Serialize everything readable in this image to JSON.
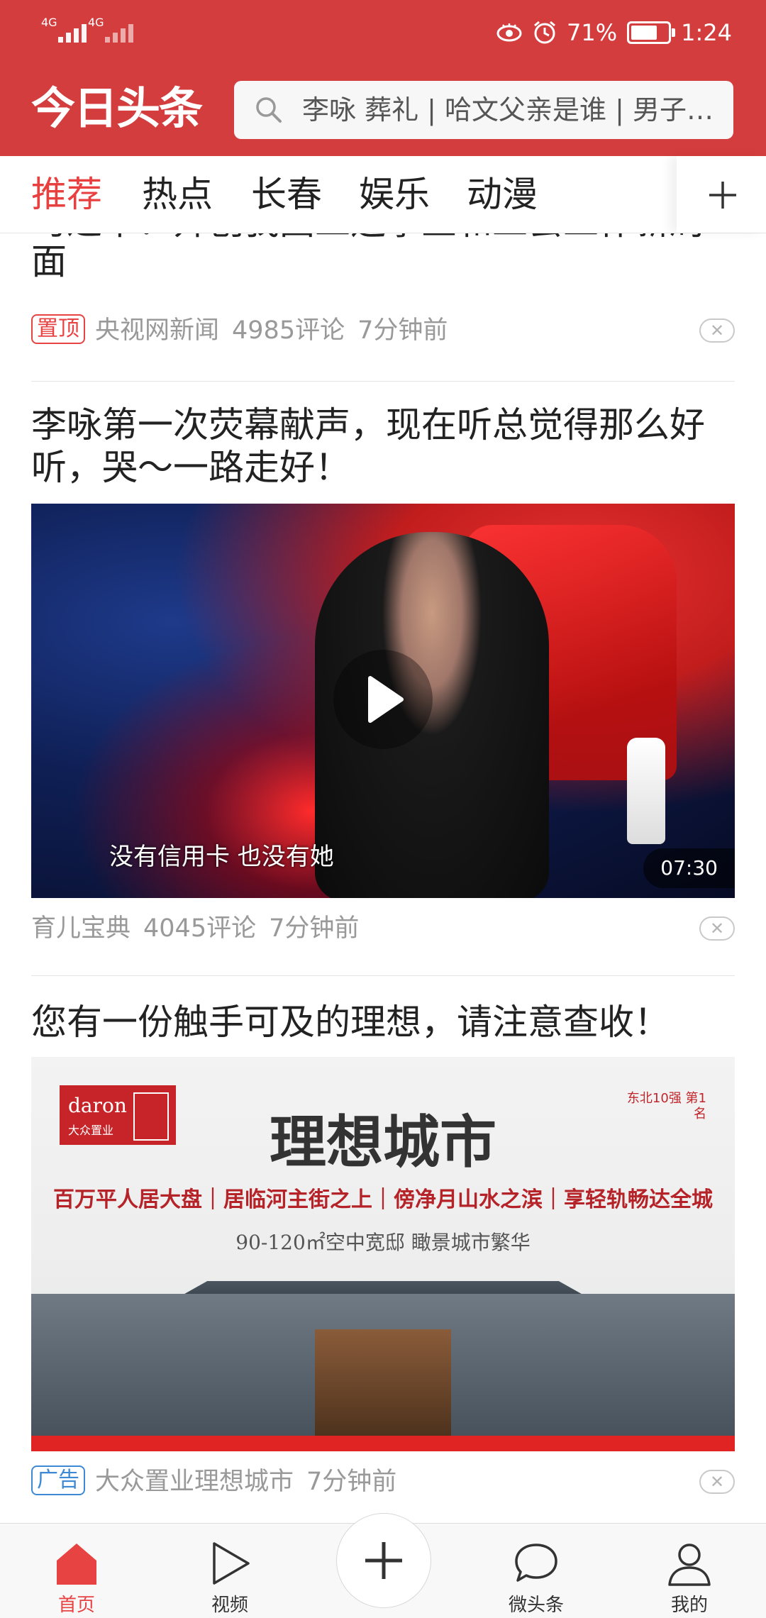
{
  "status_bar": {
    "sim1_label": "4G",
    "sim2_label": "4G",
    "battery_percent": "71%",
    "battery_level": 0.71,
    "time": "1:24",
    "icons": [
      "eye-comfort-icon",
      "alarm-icon",
      "battery-icon"
    ]
  },
  "header": {
    "logo": "今日头条",
    "search_placeholder": "李咏 葬礼 | 哈文父亲是谁 | 男子…",
    "background_color": "#d43d3d"
  },
  "tabs": {
    "items": [
      "推荐",
      "热点",
      "长春",
      "娱乐",
      "动漫"
    ],
    "active_index": 0,
    "active_color": "#e83f3f"
  },
  "feed": {
    "article1": {
      "title_partial_top": "习近平：开创我国工运事业和工会工作新局",
      "title_last_line": "面",
      "badge": "置顶",
      "source": "央视网新闻",
      "comments": "4985评论",
      "time": "7分钟前"
    },
    "article2": {
      "title": "李咏第一次荧幕献声，现在听总觉得那么好听，哭～一路走好！",
      "video_subtitle": "没有信用卡 也没有她",
      "duration": "07:30",
      "source": "育儿宝典",
      "comments": "4045评论",
      "time": "7分钟前"
    },
    "article3": {
      "title": "您有一份触手可及的理想，请注意查收！",
      "ad_brand": "daron",
      "ad_brand_cn": "大众置业",
      "ad_ranking": "东北10强 第1名",
      "ad_headline": "理想城市",
      "ad_slogan": "百万平人居大盘｜居临河主街之上｜傍净月山水之滨｜享轻轨畅达全城",
      "ad_sub": "90-120㎡空中宽邸  瞰景城市繁华",
      "badge": "广告",
      "source": "大众置业理想城市",
      "time": "7分钟前"
    }
  },
  "bottom_nav": {
    "items": [
      {
        "label": "首页",
        "icon": "home-icon"
      },
      {
        "label": "视频",
        "icon": "video-play-icon"
      },
      {
        "label": "微头条",
        "icon": "chat-bubble-icon"
      },
      {
        "label": "我的",
        "icon": "person-icon"
      }
    ],
    "active_index": 0,
    "publish_icon": "plus-icon"
  }
}
